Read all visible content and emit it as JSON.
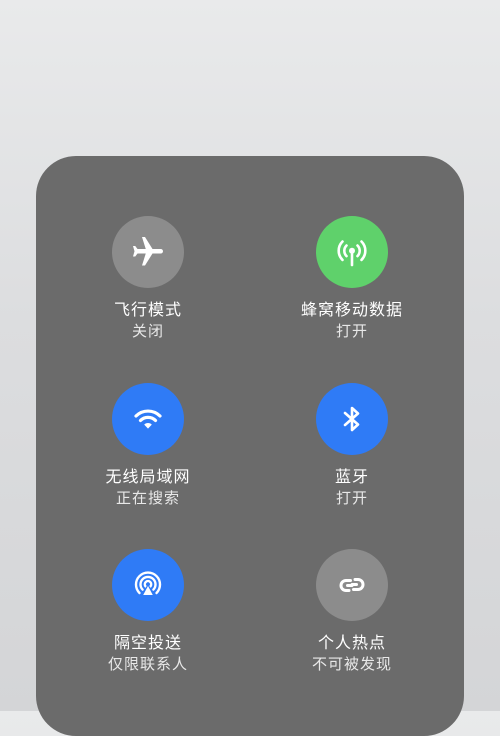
{
  "tiles": [
    {
      "title": "飞行模式",
      "status": "关闭",
      "color": "#8c8c8c",
      "icon": "airplane-icon"
    },
    {
      "title": "蜂窝移动数据",
      "status": "打开",
      "color": "#5fd16b",
      "icon": "cellular-antenna-icon"
    },
    {
      "title": "无线局域网",
      "status": "正在搜索",
      "color": "#2f7bf6",
      "icon": "wifi-icon"
    },
    {
      "title": "蓝牙",
      "status": "打开",
      "color": "#2f7bf6",
      "icon": "bluetooth-icon"
    },
    {
      "title": "隔空投送",
      "status": "仅限联系人",
      "color": "#2f7bf6",
      "icon": "airdrop-icon"
    },
    {
      "title": "个人热点",
      "status": "不可被发现",
      "color": "#8c8c8c",
      "icon": "hotspot-link-icon"
    }
  ]
}
